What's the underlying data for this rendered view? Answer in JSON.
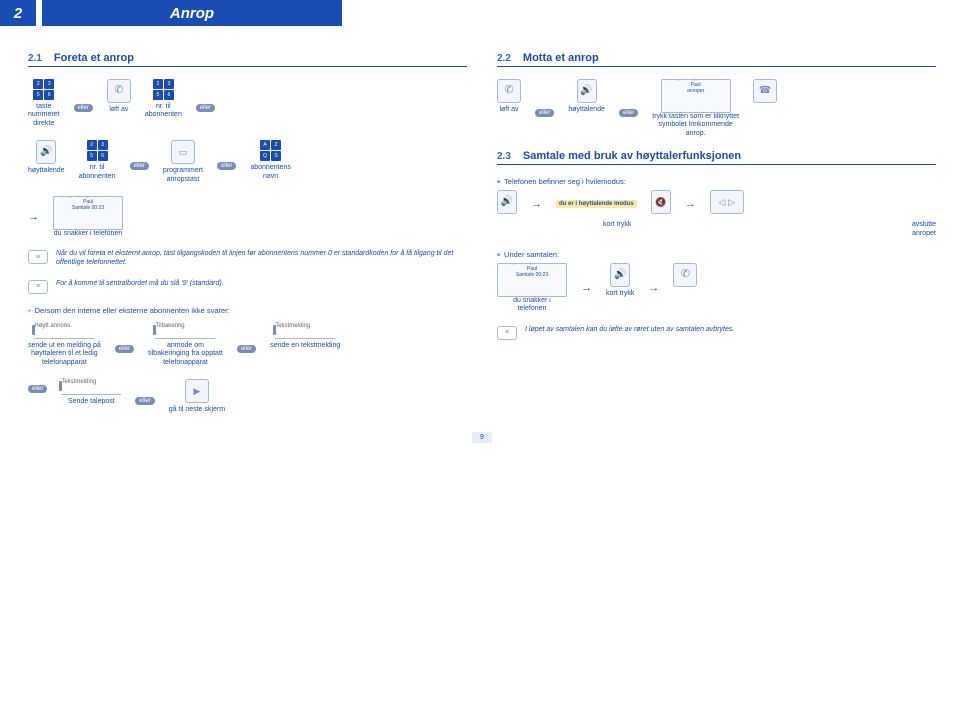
{
  "header": {
    "chapter_num": "2",
    "chapter_title": "Anrop"
  },
  "eller": "eller",
  "left": {
    "s1": {
      "num": "2.1",
      "title": "Foreta et anrop"
    },
    "row1": {
      "a": "taste\nnummeret\ndirekte",
      "b": "løft av",
      "c": "nr. til\nabonnenten"
    },
    "row2": {
      "a": "høyttalende",
      "b": "nr. til\nabonnenten",
      "c": "programmert\nanropstast",
      "d": "abonnentens\nnavn"
    },
    "screen1": {
      "l1": "Paul",
      "l2": "Samtale 00:23"
    },
    "screen1_cap": "du snakker i telefonen",
    "note1": "Når du vil foreta et eksternt anrop, tast tilgangskoden til linjen før abonnentens nummer 0 er standardkoden for å få tilgang til det offentlige telefonnettet.",
    "note2": "For å komme til sentralbordet må du slå '9' (standard).",
    "sub1": "Dersom den interne eller eksterne abonnenten ikke svarer:",
    "row3": {
      "btn1": "Høytt.annons.",
      "btn2": "Tilbakering",
      "btn3": "Tekstmelding",
      "cap1": "sende ut en melding på\nhøyttaleren til et ledig\ntelefonapparat",
      "cap2": "anmode om\ntilbakeringing fra opptatt\ntelefonapparat",
      "cap3": "sende en tekstmelding"
    },
    "row4": {
      "btn1": "Tekstmelding",
      "cap1": "Sende talepost",
      "cap2": "gå til neste skjerm"
    }
  },
  "right": {
    "s1": {
      "num": "2.2",
      "title": "Motta et anrop"
    },
    "row1": {
      "a": "løft av",
      "b": "høyttalende",
      "c": "trykk tasten som er tilknyttet\nsymbolet Innkommende\nanrop.",
      "screen": {
        "l1": "Paul",
        "l2": "anroper"
      }
    },
    "s2": {
      "num": "2.3",
      "title": "Samtale med bruk av høyttalerfunksjonen"
    },
    "bullet1": "Telefonen befinner seg i hvilemodus:",
    "yellow1": "du er i høyttalende modus",
    "row2": {
      "a": "kort trykk",
      "b": "avslutte\nanropet"
    },
    "bullet2": "Under samtalen:",
    "screen2": {
      "l1": "Paul",
      "l2": "Samtale 00:23"
    },
    "screen2_cap": "du snakker i\ntelefonen",
    "row3": {
      "a": "kort trykk"
    },
    "note3": "I løpet av samtalen kan du løfte av røret uten av samtalen avbrytes."
  },
  "page": "9"
}
